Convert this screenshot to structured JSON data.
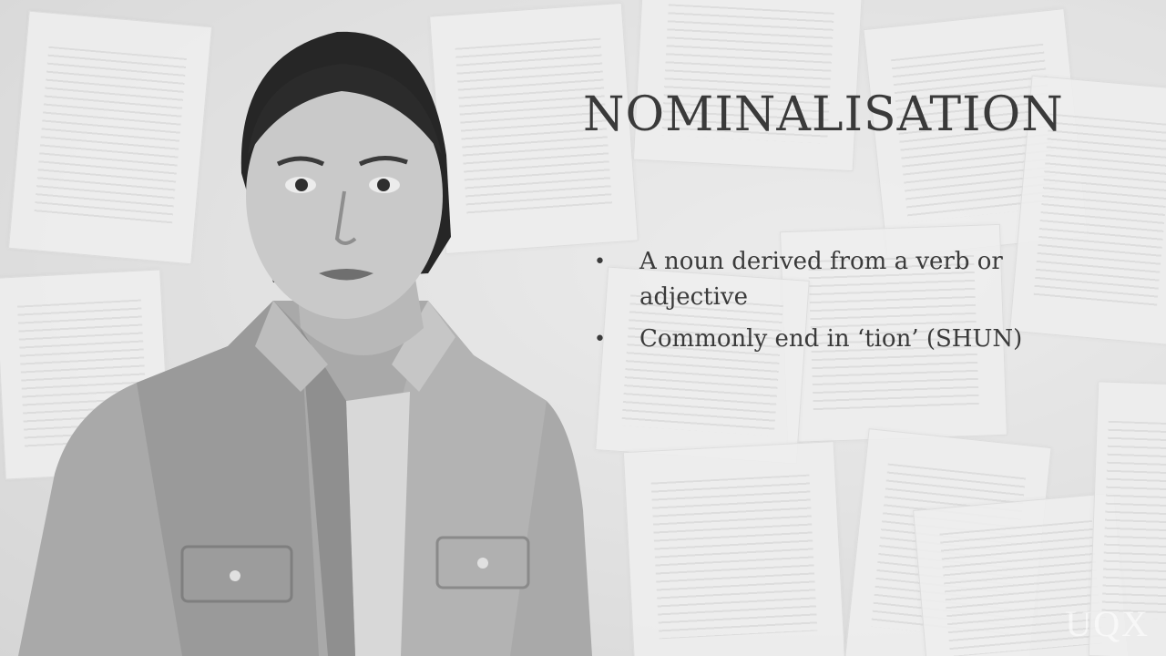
{
  "slide": {
    "title": "NOMINALISATION",
    "bullets": [
      "A noun derived from a verb or adjective",
      "Commonly end in ‘tion’ (SHUN)"
    ],
    "bullet_symbol": "•"
  },
  "watermark": {
    "text": "UQX"
  },
  "colors": {
    "text": "#3a3a3a",
    "background": "#d9d9d9"
  }
}
